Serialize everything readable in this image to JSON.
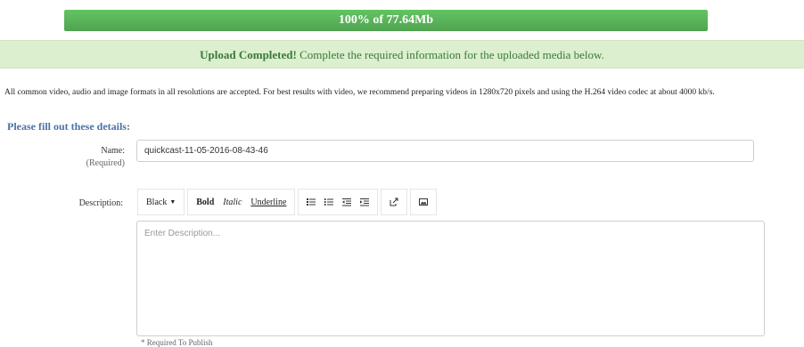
{
  "progress": {
    "percent": 100,
    "label": "100% of 77.64Mb",
    "fill_color": "#5cb85c"
  },
  "upload_status": {
    "strong": "Upload Completed!",
    "message": " Complete the required information for the uploaded media below."
  },
  "info": {
    "text": "All common video, audio and image formats in all resolutions are accepted. For best results with video, we recommend preparing videos in 1280x720 pixels and using the H.264 video codec at about 4000 kb/s."
  },
  "form": {
    "heading": "Please fill out these details:",
    "name_label": "Name:",
    "name_required": "(Required)",
    "name_value": "quickcast-11-05-2016-08-43-46",
    "description_label": "Description:",
    "description_placeholder": "Enter Description...",
    "required_note": "* Required To Publish"
  },
  "toolbar": {
    "color_label": "Black",
    "bold_label": "Bold",
    "italic_label": "Italic",
    "underline_label": "Underline",
    "icons": [
      "unordered-list-icon",
      "ordered-list-icon",
      "outdent-icon",
      "indent-icon",
      "link-icon",
      "image-icon"
    ]
  },
  "colors": {
    "progress": "#5cb85c",
    "success_bg": "#dcefcf",
    "success_text": "#3a7a3a",
    "heading": "#4a72a4"
  }
}
